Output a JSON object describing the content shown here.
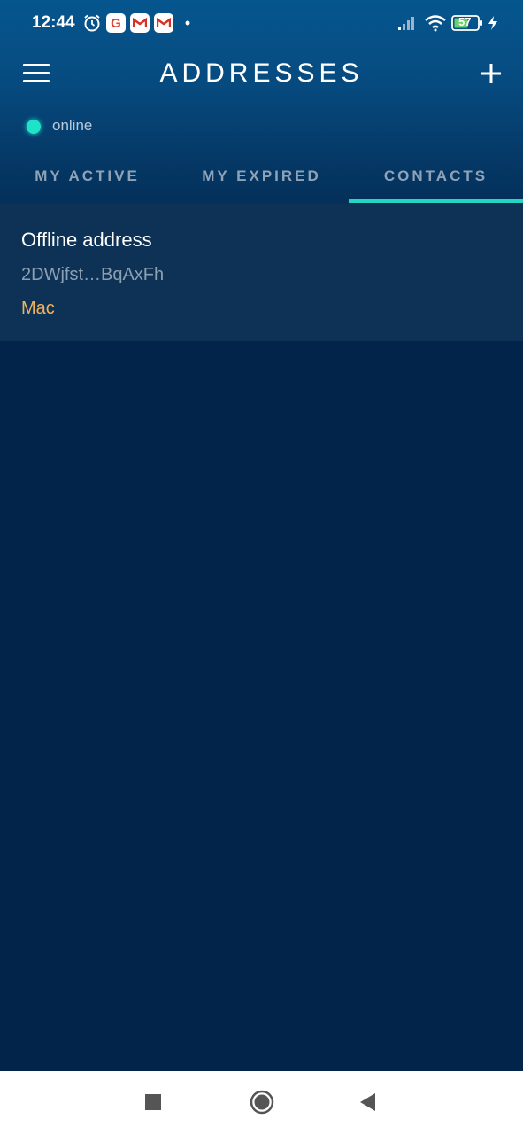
{
  "status_bar": {
    "time": "12:44",
    "google_letter": "G",
    "battery_level": "57",
    "dot": "•"
  },
  "app_bar": {
    "title": "ADDRESSES"
  },
  "connection": {
    "status": "online",
    "color": "#1ee3c8"
  },
  "tabs": [
    {
      "label": "MY ACTIVE",
      "active": false
    },
    {
      "label": "MY EXPIRED",
      "active": false
    },
    {
      "label": "CONTACTS",
      "active": true
    }
  ],
  "contacts": [
    {
      "name": "Offline address",
      "address": "2DWjfst…BqAxFh",
      "tag": "Mac"
    }
  ],
  "colors": {
    "accent": "#24d6c2",
    "tag": "#f2b25c",
    "background": "#03244a"
  }
}
